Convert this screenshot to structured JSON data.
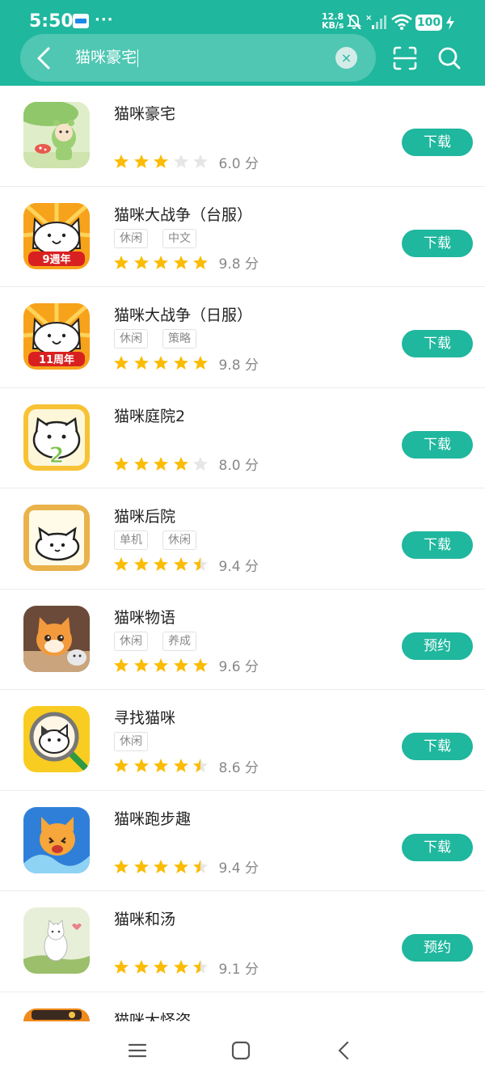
{
  "status_bar": {
    "time": "5:50",
    "more": "···",
    "net_speed_value": "12.8",
    "net_speed_unit": "KB/s",
    "battery": "100",
    "icons": [
      "calendar-notification-icon",
      "mute-icon",
      "signal-icon",
      "wifi-icon",
      "battery-icon",
      "charging-icon"
    ]
  },
  "search": {
    "query": "猫咪豪宅",
    "clear_symbol": "×"
  },
  "colors": {
    "accent": "#1fb79e",
    "star": "#fbbc05",
    "star_empty": "#e6e6e6",
    "tag_text": "#8a8a8a"
  },
  "results": [
    {
      "name": "猫咪豪宅",
      "tags": [],
      "stars": 3,
      "score": "6.0 分",
      "button": "下载",
      "icon": "frog-girl-umbrella-icon"
    },
    {
      "name": "猫咪大战争（台服）",
      "tags": [
        "休闲",
        "中文"
      ],
      "stars": 5,
      "score": "9.8 分",
      "button": "下载",
      "icon": "battle-cats-9th-anniversary-icon",
      "badge": "9週年"
    },
    {
      "name": "猫咪大战争（日服）",
      "tags": [
        "休闲",
        "策略"
      ],
      "stars": 5,
      "score": "9.8 分",
      "button": "下载",
      "icon": "battle-cats-11th-anniversary-icon",
      "badge": "11周年"
    },
    {
      "name": "猫咪庭院2",
      "tags": [],
      "stars": 4,
      "score": "8.0 分",
      "button": "下载",
      "icon": "cat-garden-2-icon",
      "badge": "2"
    },
    {
      "name": "猫咪后院",
      "tags": [
        "单机",
        "休闲"
      ],
      "stars": 4.5,
      "score": "9.4 分",
      "button": "下载",
      "icon": "neko-atsume-icon"
    },
    {
      "name": "猫咪物语",
      "tags": [
        "休闲",
        "养成"
      ],
      "stars": 5,
      "score": "9.6 分",
      "button": "预约",
      "icon": "orange-cat-story-icon"
    },
    {
      "name": "寻找猫咪",
      "tags": [
        "休闲"
      ],
      "stars": 4.5,
      "score": "8.6 分",
      "button": "下载",
      "icon": "find-cat-magnifier-icon"
    },
    {
      "name": "猫咪跑步趣",
      "tags": [],
      "stars": 4.5,
      "score": "9.4 分",
      "button": "下载",
      "icon": "running-cat-icon"
    },
    {
      "name": "猫咪和汤",
      "tags": [],
      "stars": 4.5,
      "score": "9.1 分",
      "button": "预约",
      "icon": "cats-and-soup-icon"
    },
    {
      "name": "猫咪大怪盗",
      "tags": [],
      "stars": 0,
      "score": "",
      "button": "",
      "icon": "cat-thief-icon"
    }
  ],
  "nav": {
    "icons": [
      "menu-icon",
      "home-icon",
      "back-icon"
    ]
  }
}
